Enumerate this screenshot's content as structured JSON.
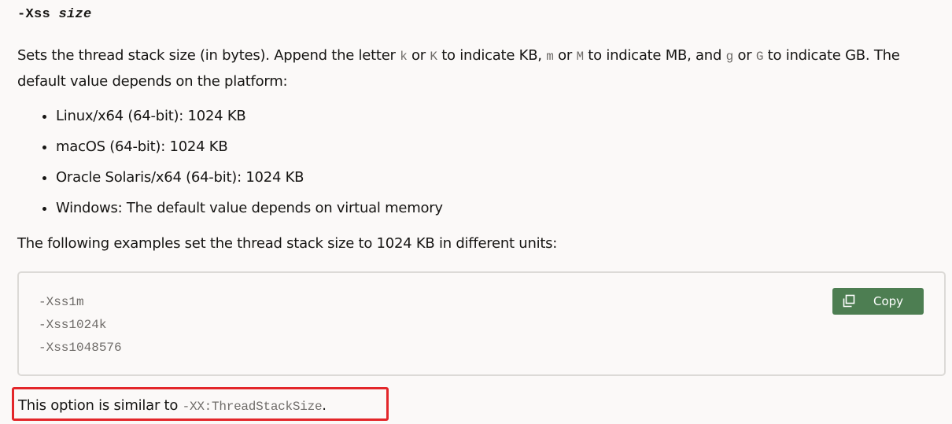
{
  "option": {
    "flag": "-Xss",
    "arg": "size"
  },
  "description": {
    "part1": "Sets the thread stack size (in bytes). Append the letter ",
    "k_lower": "k",
    "or1": " or ",
    "k_upper": "K",
    "part2": " to indicate KB, ",
    "m_lower": "m",
    "or2": " or ",
    "m_upper": "M",
    "part3": " to indicate MB, and ",
    "g_lower": "g",
    "or3": " or ",
    "g_upper": "G",
    "part4": " to indicate GB. The default value depends on the platform:"
  },
  "platforms": [
    "Linux/x64 (64-bit): 1024 KB",
    "macOS (64-bit): 1024 KB",
    "Oracle Solaris/x64 (64-bit): 1024 KB",
    "Windows: The default value depends on virtual memory"
  ],
  "examples_intro": "The following examples set the thread stack size to 1024 KB in different units:",
  "code_block": {
    "lines": [
      "-Xss1m",
      "-Xss1024k",
      "-Xss1048576"
    ],
    "copy_label": "Copy",
    "copy_icon": "copy-icon"
  },
  "similar": {
    "prefix": "This option is similar to ",
    "code": "-XX:ThreadStackSize",
    "suffix": "."
  },
  "colors": {
    "background": "#fbf9f8",
    "text": "#161513",
    "code_text": "#6f6c69",
    "copy_button": "#4d7e52",
    "highlight_border": "#e3262a"
  }
}
